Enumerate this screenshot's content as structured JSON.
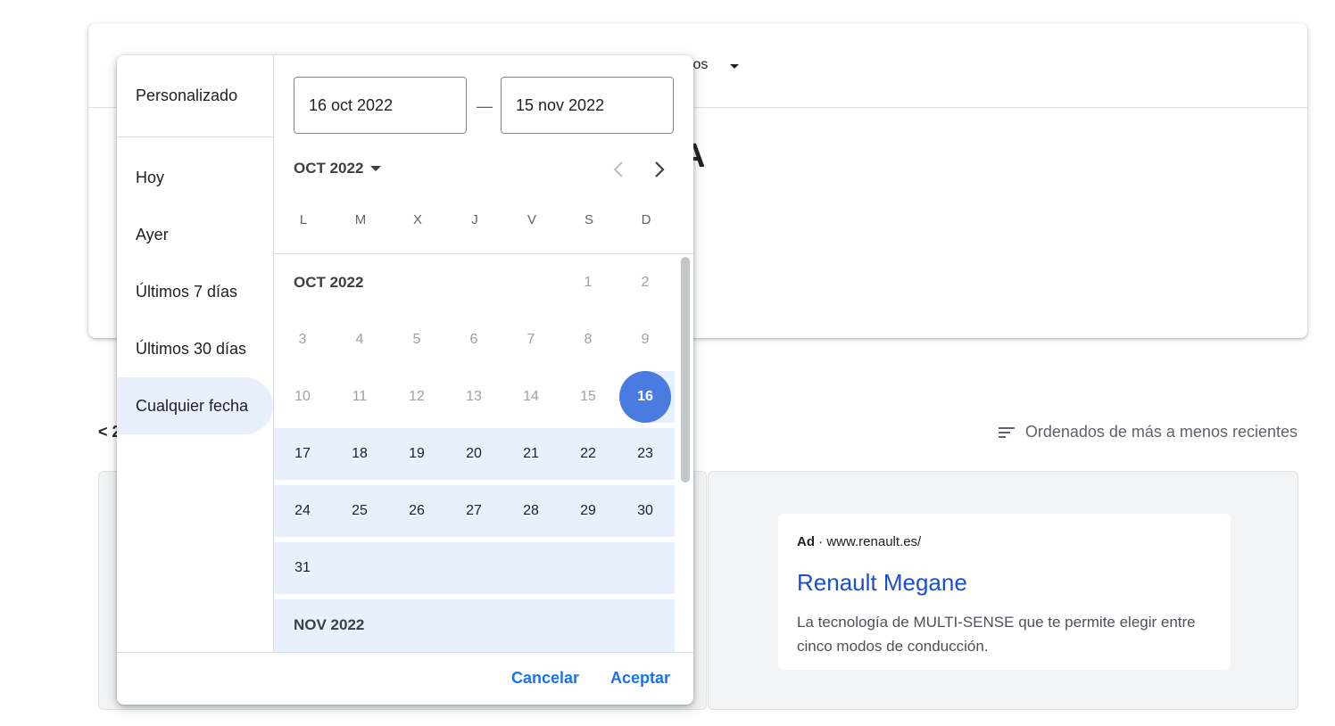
{
  "background": {
    "header_label": "tos",
    "big_letter": "A",
    "back_link": "< 2",
    "sort_label": "Ordenados de más a menos recientes"
  },
  "ad": {
    "badge": "Ad",
    "separator": "·",
    "url": "www.renault.es/",
    "title": "Renault Megane",
    "description": "La tecnología de MULTI-SENSE que te permite elegir entre cinco modos de conducción."
  },
  "picker": {
    "presets": [
      {
        "label": "Personalizado"
      },
      {
        "label": "Hoy"
      },
      {
        "label": "Ayer"
      },
      {
        "label": "Últimos 7 días"
      },
      {
        "label": "Últimos 30 días"
      },
      {
        "label": "Cualquier fecha",
        "active": true
      }
    ],
    "start_date": "16 oct 2022",
    "end_date": "15 nov 2022",
    "dash": "—",
    "month_select": "OCT 2022",
    "weekdays": [
      "L",
      "M",
      "X",
      "J",
      "V",
      "S",
      "D"
    ],
    "months": [
      {
        "label": "OCT 2022",
        "first_weekday": 5,
        "days": 31,
        "selected_day": 16
      },
      {
        "label": "NOV 2022"
      }
    ],
    "cancel_label": "Cancelar",
    "accept_label": "Aceptar"
  },
  "colors": {
    "accent": "#1a73e8",
    "selected": "#4a7be0",
    "range": "#e8f0fe",
    "ad_link": "#1a4fcf"
  }
}
